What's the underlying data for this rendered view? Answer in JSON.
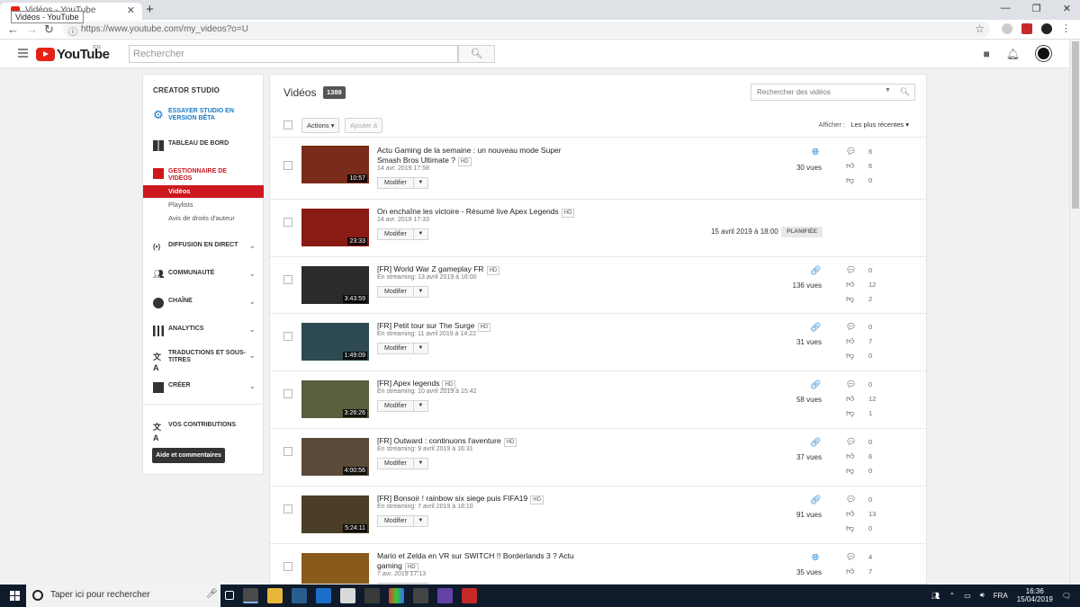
{
  "browser": {
    "tab_title": "Vidéos - YouTube",
    "tooltip": "Vidéos - YouTube",
    "new_tab": "+",
    "url": "https://www.youtube.com/my_videos?o=U"
  },
  "header": {
    "logo_text": "YouTube",
    "region": "FR",
    "search_placeholder": "Rechercher"
  },
  "sidebar": {
    "title": "CREATOR STUDIO",
    "items": [
      {
        "label": "ESSAYER STUDIO EN VERSION BÊTA"
      },
      {
        "label": "TABLEAU DE BORD"
      },
      {
        "label": "GESTIONNAIRE DE VIDÉOS"
      },
      {
        "label": "DIFFUSION EN DIRECT"
      },
      {
        "label": "COMMUNAUTÉ"
      },
      {
        "label": "CHAÎNE"
      },
      {
        "label": "ANALYTICS"
      },
      {
        "label": "TRADUCTIONS ET SOUS-TITRES"
      },
      {
        "label": "CRÉER"
      },
      {
        "label": "VOS CONTRIBUTIONS"
      }
    ],
    "subitems": [
      {
        "label": "Vidéos"
      },
      {
        "label": "Playlists"
      },
      {
        "label": "Avis de droits d'auteur"
      }
    ],
    "help_button": "Aide et commentaires"
  },
  "main": {
    "title": "Vidéos",
    "count": "1389",
    "search_placeholder": "Rechercher des vidéos",
    "actions_label": "Actions",
    "add_to_label": "Ajouter à",
    "show_label": "Afficher :",
    "sort_label": "Les plus récentes",
    "modify_label": "Modifier",
    "hd_label": "HD",
    "videos": [
      {
        "title": "Actu Gaming de la semaine : un nouveau mode Super Smash Bros Ultimate ?",
        "date": "14 avr. 2019 17:58",
        "duration": "10:57",
        "visibility": "public",
        "views": "30 vues",
        "comments": "6",
        "likes": "6",
        "dislikes": "0",
        "thumb_color": "#7a2c1a"
      },
      {
        "title": "On enchaîne les victoire - Résumé live Apex Legends",
        "date": "14 avr. 2019 17:33",
        "duration": "23:33",
        "scheduled": "15 avril 2019 à 18:00",
        "status": "PLANIFIÉE",
        "thumb_color": "#8a1b14"
      },
      {
        "title": "[FR] World War Z gameplay FR",
        "date": "En streaming: 13 avril 2019 à 16:00",
        "duration": "3:43:59",
        "visibility": "unlisted",
        "views": "136 vues",
        "comments": "0",
        "likes": "12",
        "dislikes": "2",
        "thumb_color": "#2b2b2b"
      },
      {
        "title": "[FR] Petit tour sur The Surge",
        "date": "En streaming: 11 avril 2019 à 14:22",
        "duration": "1:49:09",
        "visibility": "unlisted",
        "views": "31 vues",
        "comments": "0",
        "likes": "7",
        "dislikes": "0",
        "thumb_color": "#2e4a52"
      },
      {
        "title": "[FR] Apex legends",
        "date": "En streaming: 10 avril 2019 à 15:42",
        "duration": "3:26:26",
        "visibility": "unlisted",
        "views": "58 vues",
        "comments": "0",
        "likes": "12",
        "dislikes": "1",
        "thumb_color": "#5a5e3c"
      },
      {
        "title": "[FR] Outward : continuons l'aventure",
        "date": "En streaming: 9 avril 2019 à 16:31",
        "duration": "4:00:56",
        "visibility": "unlisted",
        "views": "37 vues",
        "comments": "0",
        "likes": "6",
        "dislikes": "0",
        "thumb_color": "#5c4a3a"
      },
      {
        "title": "[FR] Bonsoir ! rainbow six siege puis FIFA19",
        "date": "En streaming: 7 avril 2019 à 18:10",
        "duration": "5:24:11",
        "visibility": "unlisted",
        "views": "91 vues",
        "comments": "0",
        "likes": "13",
        "dislikes": "0",
        "thumb_color": "#4a3e26"
      },
      {
        "title": "Mario et Zelda en VR sur SWITCH !! Borderlands 3 ? Actu gaming",
        "date": "7 avr. 2019 17:13",
        "duration": "",
        "visibility": "public",
        "views": "35 vues",
        "comments": "4",
        "likes": "7",
        "dislikes": "",
        "thumb_color": "#8a5a1a"
      }
    ]
  },
  "taskbar": {
    "search_text": "Taper ici pour rechercher",
    "lang": "FRA",
    "time": "16:36",
    "date": "15/04/2019"
  }
}
